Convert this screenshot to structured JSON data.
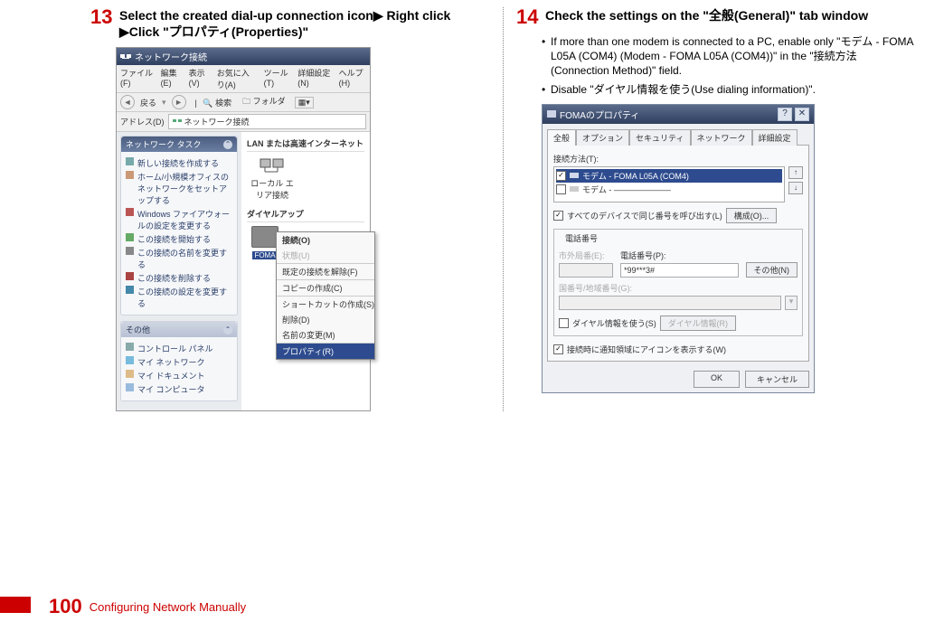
{
  "left": {
    "step_num": "13",
    "step_title": "Select the created dial-up connection icon▶ Right click ▶Click \"プロパティ(Properties)\"",
    "explorer": {
      "title": "ネットワーク接続",
      "menu": [
        "ファイル(F)",
        "編集(E)",
        "表示(V)",
        "お気に入り(A)",
        "ツール(T)",
        "詳細設定(N)",
        "ヘルプ(H)"
      ],
      "back": "戻る",
      "search": "検索",
      "folders": "フォルダ",
      "addr_label": "アドレス(D)",
      "addr_value": "ネットワーク接続",
      "side_tasks_title": "ネットワーク タスク",
      "side_tasks": [
        "新しい接続を作成する",
        "ホーム/小規模オフィスのネットワークをセットアップする",
        "Windows ファイアウォールの設定を変更する",
        "この接続を開始する",
        "この接続の名前を変更する",
        "この接続を削除する",
        "この接続の設定を変更する"
      ],
      "side_other_title": "その他",
      "side_other": [
        "コントロール パネル",
        "マイ ネットワーク",
        "マイ ドキュメント",
        "マイ コンピュータ"
      ],
      "lan_heading": "LAN または高速インターネット",
      "lan_item": "ローカル エリア接続",
      "dial_heading": "ダイヤルアップ",
      "foma_label": "FOMA",
      "ctx": [
        "接続(O)",
        "状態(U)",
        "既定の接続を解除(F)",
        "コピーの作成(C)",
        "ショートカットの作成(S)",
        "削除(D)",
        "名前の変更(M)",
        "プロパティ(R)"
      ]
    }
  },
  "right": {
    "step_num": "14",
    "step_title": "Check the settings on the \"全般(General)\" tab window",
    "bullets": [
      "If more than one modem is connected to a PC, enable only \"モデム - FOMA L05A (COM4) (Modem - FOMA L05A (COM4))\" in the \"接続方法 (Connection Method)\" field.",
      "Disable \"ダイヤル情報を使う(Use dialing information)\"."
    ],
    "dialog": {
      "title": "FOMAのプロパティ",
      "tabs": [
        "全般",
        "オプション",
        "セキュリティ",
        "ネットワーク",
        "詳細設定"
      ],
      "conn_method_label": "接続方法(T):",
      "modems": [
        {
          "checked": true,
          "label": "モデム - FOMA L05A (COM4)"
        },
        {
          "checked": false,
          "label": "モデム - ———————"
        }
      ],
      "all_devices": "すべてのデバイスで同じ番号を呼び出す(L)",
      "configure": "構成(O)...",
      "phone_group": "電話番号",
      "area_label": "市外局番(E):",
      "phone_label": "電話番号(P):",
      "phone_value": "*99***3#",
      "other": "その他(N)",
      "country_label": "国番号/地域番号(G):",
      "use_dial": "ダイヤル情報を使う(S)",
      "dial_rules": "ダイヤル情報(R)",
      "show_icon": "接続時に通知領域にアイコンを表示する(W)",
      "ok": "OK",
      "cancel": "キャンセル"
    }
  },
  "footer": {
    "page": "100",
    "text": "Configuring Network Manually"
  }
}
